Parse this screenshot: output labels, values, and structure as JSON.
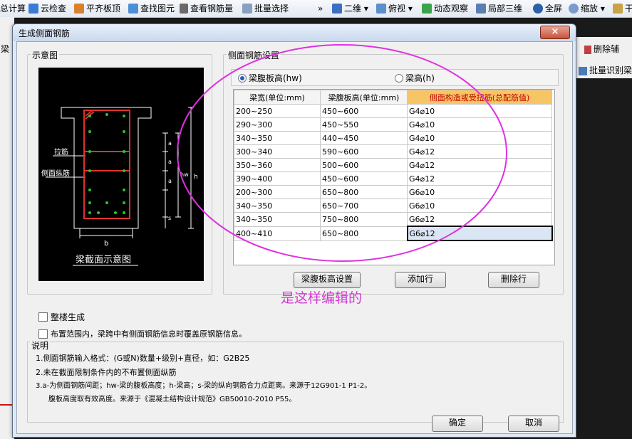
{
  "toolbar": {
    "items": [
      "总计算",
      "云检查",
      "平齐板顶",
      "查找图元",
      "查看钢筋量",
      "批量选择",
      "二维",
      "俯视",
      "动态观察",
      "局部三维",
      "全屏",
      "缩放",
      "干"
    ],
    "more": "»"
  },
  "background": {
    "left": [
      "梁"
    ],
    "right": [
      "删除辅",
      "批量识别梁"
    ]
  },
  "dialog": {
    "title": "生成侧面钢筋",
    "close_label": "×",
    "diagram_group": "示意图",
    "diagram": {
      "labels": {
        "tie": "拉筋",
        "side_bar": "侧面纵筋",
        "b": "b",
        "a": "a",
        "hw": "hw",
        "h": "h",
        "s": "s"
      },
      "caption": "梁截面示意图"
    },
    "settings_group": "侧面钢筋设置",
    "radios": [
      {
        "label": "梁腹板高(hw)",
        "checked": true
      },
      {
        "label": "梁高(h)",
        "checked": false
      }
    ],
    "table": {
      "headers": [
        "梁宽(单位:mm)",
        "梁腹板高(单位:mm)",
        "侧面构造或受扭筋(总配筋值)"
      ],
      "rows": [
        [
          "200~250",
          "450~600",
          "G4⌀10"
        ],
        [
          "290~300",
          "450~550",
          "G4⌀10"
        ],
        [
          "340~350",
          "440~450",
          "G4⌀10"
        ],
        [
          "300~340",
          "590~600",
          "G4⌀12"
        ],
        [
          "350~360",
          "500~600",
          "G4⌀12"
        ],
        [
          "390~400",
          "450~600",
          "G4⌀12"
        ],
        [
          "200~300",
          "650~800",
          "G6⌀10"
        ],
        [
          "340~350",
          "650~700",
          "G6⌀10"
        ],
        [
          "340~350",
          "750~800",
          "G6⌀12"
        ],
        [
          "400~410",
          "650~800",
          "G6⌀12"
        ]
      ]
    },
    "buttons": {
      "web_height": "梁腹板高设置",
      "add_row": "添加行",
      "delete_row": "删除行",
      "ok": "确定",
      "cancel": "取消"
    },
    "checkboxes": [
      "整楼生成",
      "布置范围内，梁跨中有侧面钢筋信息时覆盖原钢筋信息。"
    ],
    "notes_title": "说明",
    "notes": [
      "1.侧面钢筋输入格式：(G或N)数量+级别+直径，如：G2B25",
      "2.未在截面限制条件内的不布置侧面纵筋",
      "3.a-为侧面钢筋间距；hw-梁的腹板高度；h-梁高；s-梁的纵向钢筋合力点距离。来源于12G901-1 P1-2。",
      "腹板高度取有效高度。来源于《混凝土结构设计规范》GB50010-2010 P55。"
    ]
  },
  "annotation": "是这样编辑的",
  "colors": {
    "highlight_header": "#f8c565",
    "annotation": "#d239d2",
    "ellipse": "#e030e0",
    "rebar": "#e03030",
    "dots": "#22cc22"
  }
}
